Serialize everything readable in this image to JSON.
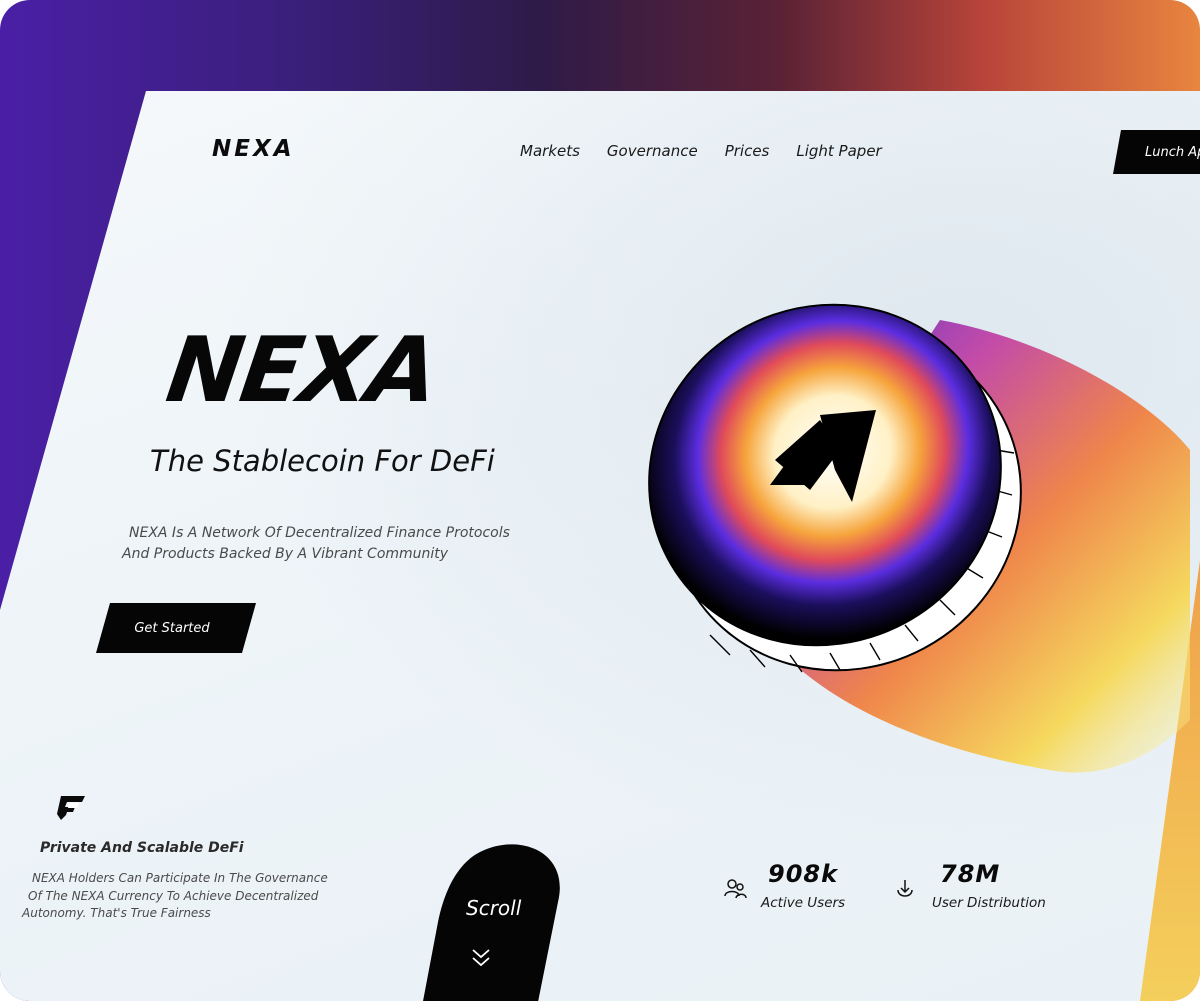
{
  "brand": {
    "logo": "NEXA"
  },
  "nav": {
    "items": [
      {
        "label": "Markets"
      },
      {
        "label": "Governance"
      },
      {
        "label": "Prices"
      },
      {
        "label": "Light Paper"
      }
    ],
    "launch_label": "Lunch App"
  },
  "hero": {
    "title": "NEXA",
    "subtitle": "The Stablecoin For DeFi",
    "description_lines": [
      "NEXA Is A Network Of Decentralized Finance Protocols",
      "And Products Backed By A Vibrant Community"
    ],
    "cta_label": "Get Started"
  },
  "feature": {
    "icon": "shield-g-icon",
    "title": "Private And Scalable DeFi",
    "description_lines": [
      "NEXA Holders Can Participate In The Governance",
      "Of The NEXA Currency To Achieve Decentralized",
      "Autonomy. That's True Fairness"
    ]
  },
  "scroll": {
    "label": "Scroll",
    "icon": "double-chevron-down-icon"
  },
  "stats": [
    {
      "value": "908k",
      "label": "Active Users",
      "icon": "users-icon"
    },
    {
      "value": "78M",
      "label": "User Distribution",
      "icon": "download-icon"
    }
  ],
  "colors": {
    "frame_left": "#4a1fa6",
    "frame_right": "#e8853f",
    "accent_yellow": "#f4cf5c",
    "text_dark": "#0a0a0a",
    "button_bg": "#050505"
  }
}
